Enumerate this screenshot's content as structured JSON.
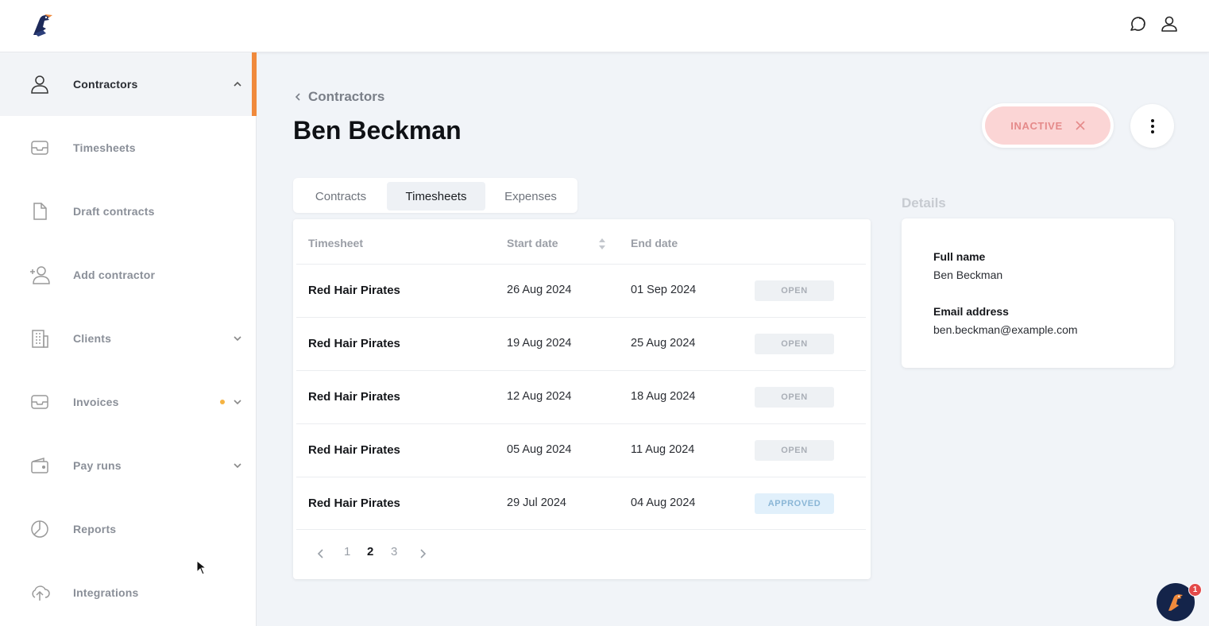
{
  "colors": {
    "accent": "#f08a3c",
    "inactive_bg": "#fbd5d5",
    "inactive_text": "#e58a8a",
    "notification_dot": "#f5b342",
    "approved_bg": "#e1f0fb",
    "fab_bg": "#14244a"
  },
  "header": {
    "logo_icon": "bird-mascot-logo",
    "icons": [
      "chat-icon",
      "user-profile-icon"
    ]
  },
  "sidebar": {
    "items": [
      {
        "label": "Contractors",
        "icon": "person-icon",
        "chevron": "up",
        "active": true
      },
      {
        "label": "Timesheets",
        "icon": "inbox-icon"
      },
      {
        "label": "Draft contracts",
        "icon": "document-icon"
      },
      {
        "label": "Add contractor",
        "icon": "person-add-icon"
      },
      {
        "label": "Clients",
        "icon": "building-icon",
        "chevron": "down"
      },
      {
        "label": "Invoices",
        "icon": "inbox-icon",
        "chevron": "down",
        "notification": true
      },
      {
        "label": "Pay runs",
        "icon": "wallet-icon",
        "chevron": "down"
      },
      {
        "label": "Reports",
        "icon": "pie-chart-icon"
      },
      {
        "label": "Integrations",
        "icon": "cloud-upload-icon"
      }
    ]
  },
  "main": {
    "breadcrumb": "Contractors",
    "title": "Ben Beckman",
    "status": "INACTIVE",
    "tabs": [
      {
        "label": "Contracts",
        "active": false
      },
      {
        "label": "Timesheets",
        "active": true
      },
      {
        "label": "Expenses",
        "active": false
      }
    ],
    "table": {
      "headers": [
        "Timesheet",
        "Start date",
        "End date"
      ],
      "rows": [
        {
          "name": "Red Hair Pirates",
          "start": "26 Aug 2024",
          "end": "01 Sep 2024",
          "status": "OPEN"
        },
        {
          "name": "Red Hair Pirates",
          "start": "19 Aug 2024",
          "end": "25 Aug 2024",
          "status": "OPEN"
        },
        {
          "name": "Red Hair Pirates",
          "start": "12 Aug 2024",
          "end": "18 Aug 2024",
          "status": "OPEN"
        },
        {
          "name": "Red Hair Pirates",
          "start": "05 Aug 2024",
          "end": "11 Aug 2024",
          "status": "OPEN"
        },
        {
          "name": "Red Hair Pirates",
          "start": "29 Jul 2024",
          "end": "04 Aug 2024",
          "status": "APPROVED"
        }
      ]
    },
    "pagination": {
      "pages": [
        "1",
        "2",
        "3"
      ],
      "current": "2"
    }
  },
  "details": {
    "title": "Details",
    "full_name_label": "Full name",
    "full_name": "Ben Beckman",
    "email_label": "Email address",
    "email": "ben.beckman@example.com"
  },
  "chat": {
    "badge_count": "1"
  }
}
